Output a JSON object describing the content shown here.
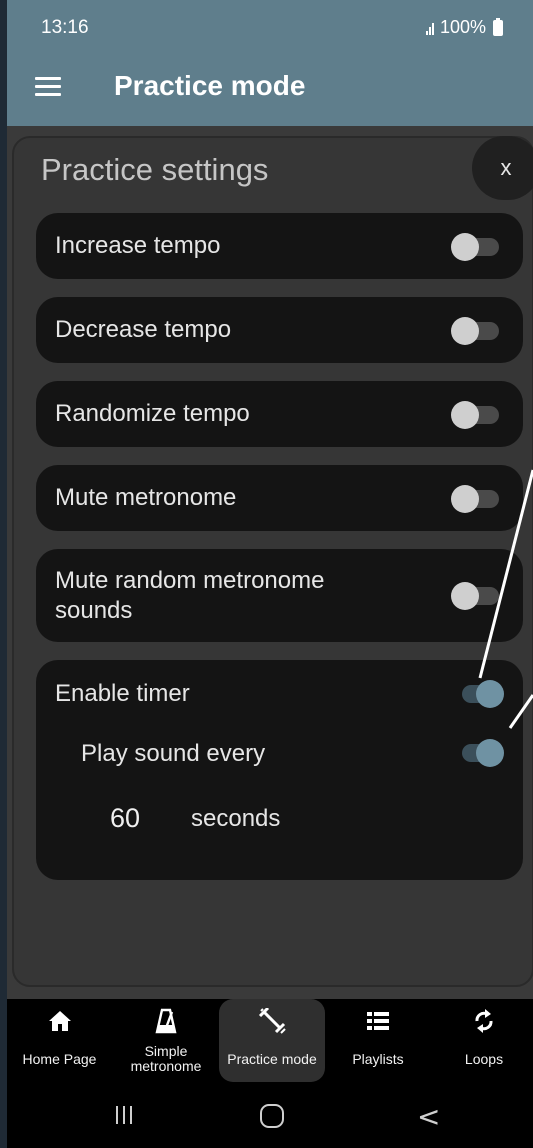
{
  "status_bar": {
    "time": "13:16",
    "battery": "100%"
  },
  "app_bar": {
    "title": "Practice mode"
  },
  "panel": {
    "title": "Practice settings",
    "close_label": "x",
    "settings": [
      {
        "label": "Increase tempo",
        "on": false
      },
      {
        "label": "Decrease tempo",
        "on": false
      },
      {
        "label": "Randomize tempo",
        "on": false
      },
      {
        "label": "Mute metronome",
        "on": false
      },
      {
        "label": "Mute random metronome sounds",
        "on": false
      }
    ],
    "timer": {
      "enable_label": "Enable timer",
      "enable_on": true,
      "play_sound_label": "Play sound every",
      "play_sound_on": true,
      "interval_value": "60",
      "interval_unit": "seconds"
    }
  },
  "bottom_nav": {
    "items": [
      {
        "label": "Home Page",
        "icon": "home-icon"
      },
      {
        "label": "Simple metronome",
        "icon": "metronome-icon"
      },
      {
        "label": "Practice mode",
        "icon": "dumbbell-icon",
        "active": true
      },
      {
        "label": "Playlists",
        "icon": "list-icon"
      },
      {
        "label": "Loops",
        "icon": "loop-icon"
      }
    ]
  },
  "colors": {
    "app_bar": "#5f7e8c",
    "toggle_on": "#6f92a3",
    "panel_bg": "#363636",
    "row_bg": "#141414"
  }
}
